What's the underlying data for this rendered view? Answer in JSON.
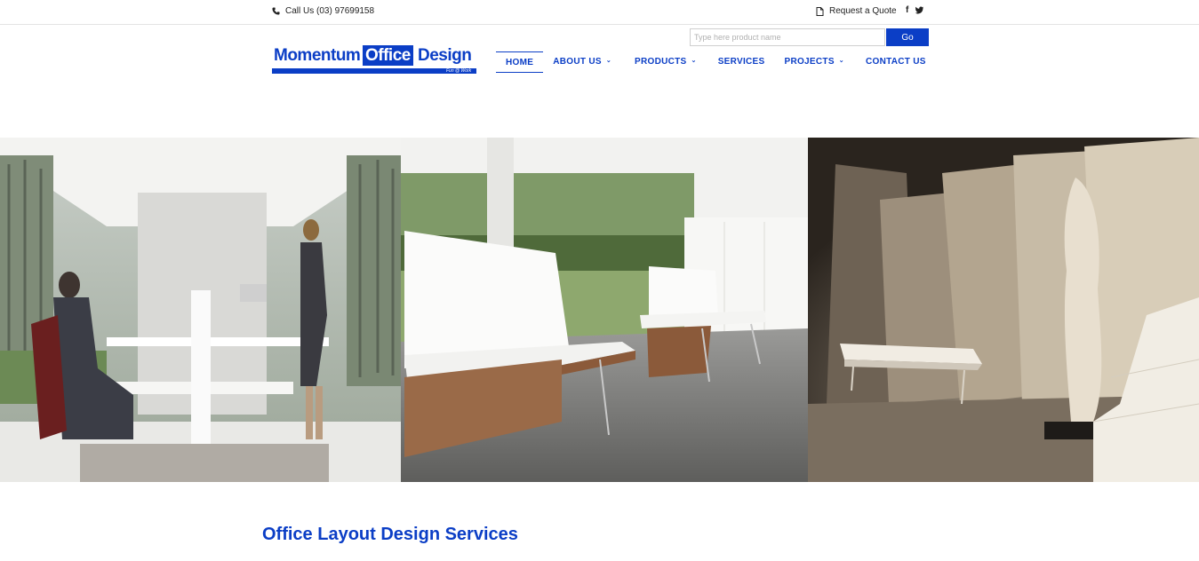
{
  "topbar": {
    "phone_icon": "phone-icon",
    "phone_text": "Call Us (03) 97699158",
    "quote_icon": "document-icon",
    "quote_text": "Request a Quote",
    "social": [
      "facebook-icon",
      "twitter-icon"
    ]
  },
  "search": {
    "placeholder": "Type here product name",
    "button_label": "Go"
  },
  "logo": {
    "word1": "Momentum",
    "word2": "Office",
    "word3": "Design",
    "tagline": "Fun @ Work"
  },
  "nav": {
    "items": [
      {
        "label": "HOME",
        "active": true
      },
      {
        "label": "ABOUT US",
        "dropdown": true
      },
      {
        "label": "PRODUCTS",
        "dropdown": true
      },
      {
        "label": "SERVICES"
      },
      {
        "label": "PROJECTS",
        "dropdown": true
      },
      {
        "label": "CONTACT US"
      }
    ]
  },
  "hero": {
    "images": [
      "office-workstations-photo",
      "lounge-bench-photo",
      "gallery-bench-sculpture-photo"
    ]
  },
  "content": {
    "heading": "Office Layout Design Services"
  },
  "colors": {
    "brand_blue": "#0b3ec6"
  }
}
